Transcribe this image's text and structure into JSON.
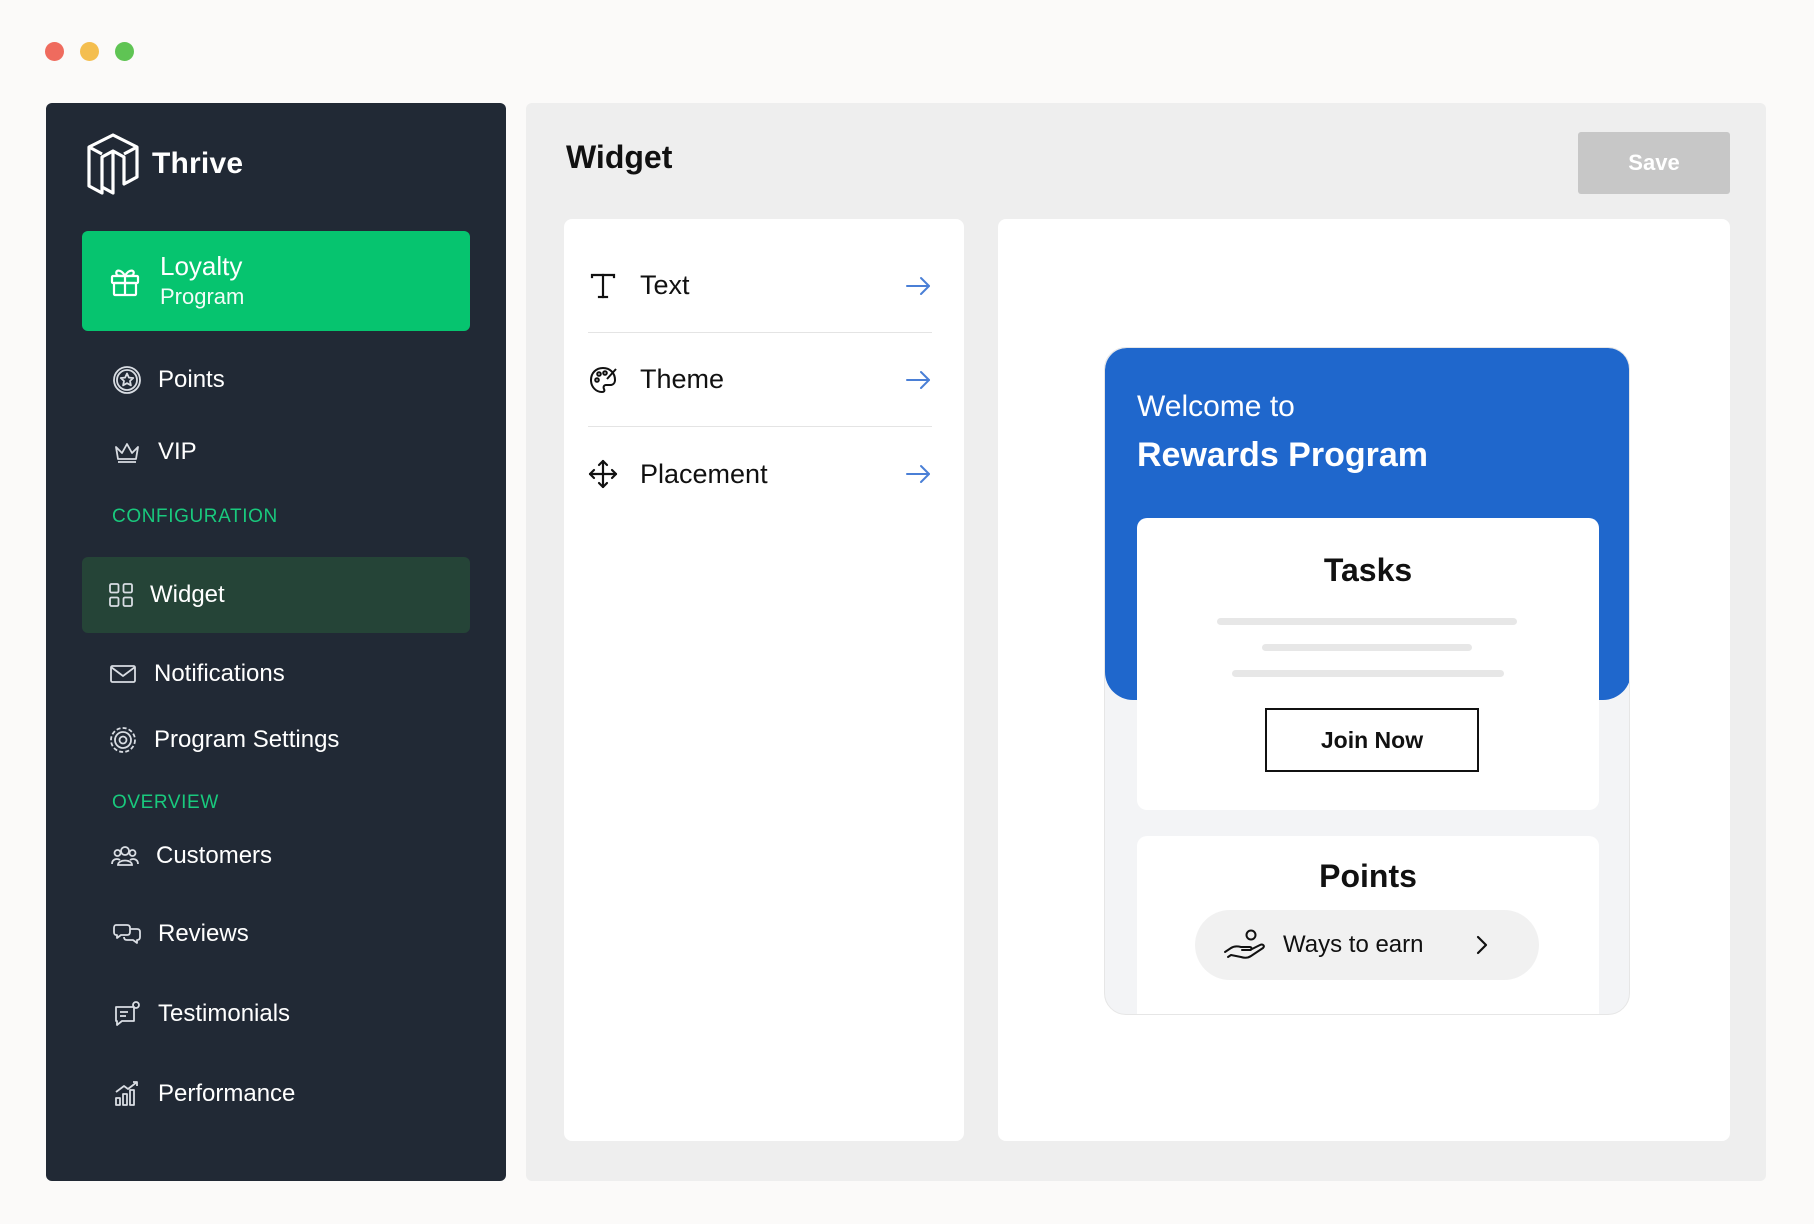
{
  "app": {
    "name": "Thrive"
  },
  "sidebar": {
    "active": {
      "label": "Loyalty",
      "sublabel": "Program"
    },
    "items_top": [
      {
        "label": "Points",
        "icon": "star-badge-icon"
      },
      {
        "label": "VIP",
        "icon": "crown-icon"
      }
    ],
    "sections": {
      "configuration": "CONFIGURATION",
      "overview": "OVERVIEW"
    },
    "config_items": [
      {
        "label": "Widget",
        "icon": "grid-icon"
      },
      {
        "label": "Notifications",
        "icon": "mail-icon"
      },
      {
        "label": "Program Settings",
        "icon": "settings-gear-icon"
      }
    ],
    "overview_items": [
      {
        "label": "Customers",
        "icon": "users-icon"
      },
      {
        "label": "Reviews",
        "icon": "chat-bubbles-icon"
      },
      {
        "label": "Testimonials",
        "icon": "testimonial-icon"
      },
      {
        "label": "Performance",
        "icon": "bar-chart-icon"
      }
    ]
  },
  "main": {
    "title": "Widget",
    "save_label": "Save",
    "settings": [
      {
        "label": "Text",
        "icon": "text-icon"
      },
      {
        "label": "Theme",
        "icon": "palette-icon"
      },
      {
        "label": "Placement",
        "icon": "move-icon"
      }
    ]
  },
  "preview": {
    "welcome": "Welcome to",
    "program_title": "Rewards Program",
    "tasks_title": "Tasks",
    "join_label": "Join Now",
    "points_title": "Points",
    "ways_label": "Ways to earn"
  },
  "colors": {
    "sidebar_bg": "#212935",
    "accent_green": "#06c46f",
    "selected_bg": "#254437",
    "widget_blue": "#1f67cc"
  }
}
